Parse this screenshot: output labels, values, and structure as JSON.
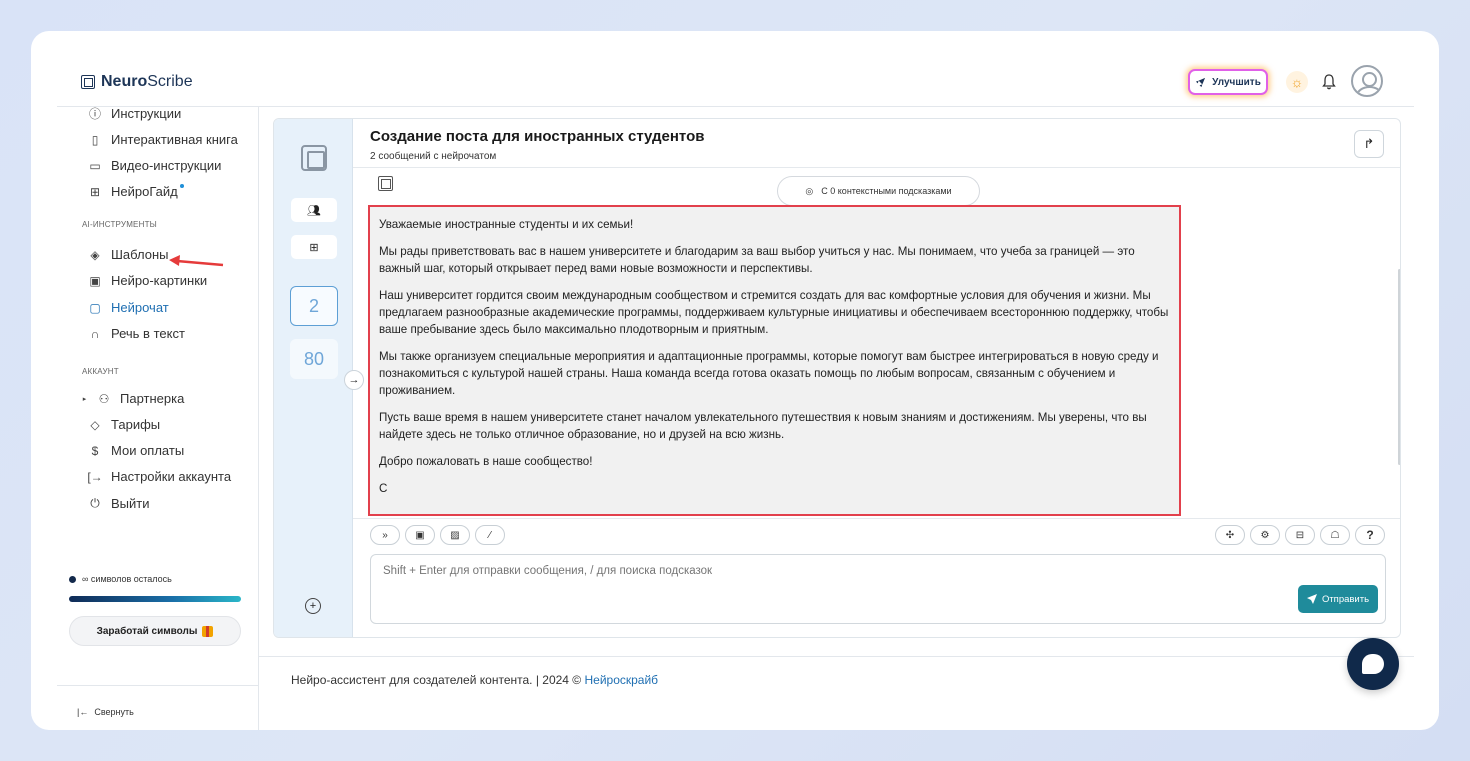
{
  "app": {
    "logo_bold": "Neuro",
    "logo_rest": "Scribe",
    "upgrade_label": "Улучшить"
  },
  "sidebar": {
    "top_items": [
      {
        "label": "Инструкции",
        "icon": "question-circle-icon"
      },
      {
        "label": "Интерактивная книга",
        "icon": "book-icon"
      },
      {
        "label": "Видео-инструкции",
        "icon": "video-icon"
      },
      {
        "label": "НейроГайд",
        "icon": "guide-icon"
      }
    ],
    "section_ai": "AI-ИНСТРУМЕНТЫ",
    "ai_items": [
      {
        "label": "Шаблоны",
        "icon": "layers-icon"
      },
      {
        "label": "Нейро-картинки",
        "icon": "image-icon"
      },
      {
        "label": "Нейрочат",
        "icon": "chat-icon"
      },
      {
        "label": "Речь в текст",
        "icon": "headphones-icon"
      }
    ],
    "section_account": "АККАУНТ",
    "account_items": [
      {
        "label": "Партнерка",
        "icon": "users-icon"
      },
      {
        "label": "Тарифы",
        "icon": "tag-icon"
      },
      {
        "label": "Мои оплаты",
        "icon": "dollar-icon"
      },
      {
        "label": "Настройки аккаунта",
        "icon": "settings-exit-icon"
      },
      {
        "label": "Выйти",
        "icon": "power-icon"
      }
    ],
    "symbols_left": "∞ символов осталось",
    "earn_label": "Заработай символы",
    "collapse_label": "Свернуть"
  },
  "rail": {
    "count_messages": "2",
    "count_other": "80"
  },
  "chat": {
    "title": "Создание поста для иностранных студентов",
    "subtitle": "2 сообщений с нейрочатом",
    "hints_label": "С 0 контекстными подсказками",
    "message_paragraphs": [
      "Уважаемые иностранные студенты и их семьи!",
      "Мы рады приветствовать вас в нашем университете и благодарим за ваш выбор учиться у нас. Мы понимаем, что учеба за границей — это важный шаг, который открывает перед вами новые возможности и перспективы.",
      "Наш университет гордится своим международным сообществом и стремится создать для вас комфортные условия для обучения и жизни. Мы предлагаем разнообразные академические программы, поддерживаем культурные инициативы и обеспечиваем всестороннюю поддержку, чтобы ваше пребывание здесь было максимально плодотворным и приятным.",
      "Мы также организуем специальные мероприятия и адаптационные программы, которые помогут вам быстрее интегрироваться в новую среду и познакомиться с культурой нашей страны. Наша команда всегда готова оказать помощь по любым вопросам, связанным с обучением и проживанием.",
      "Пусть ваше время в нашем университете станет началом увлекательного путешествия к новым знаниям и достижениям. Мы уверены, что вы найдете здесь не только отличное образование, но и друзей на всю жизнь.",
      "Добро пожаловать в наше сообщество!",
      "С"
    ],
    "input_placeholder": "Shift + Enter для отправки сообщения, / для поиска подсказок",
    "send_label": "Отправить",
    "help_label": "?"
  },
  "footer": {
    "text": "Нейро-ассистент для создателей контента.  | 2024 © ",
    "link": "Нейроскрайб"
  },
  "colors": {
    "accent": "#1f6fb2",
    "send": "#1f8b9b",
    "highlight_border": "#e2404c",
    "rail_bg": "#e7f1fa"
  }
}
